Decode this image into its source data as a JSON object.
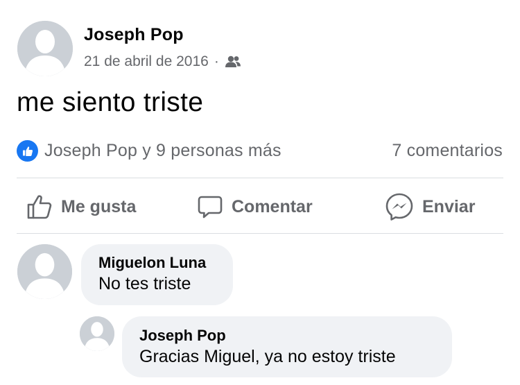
{
  "post": {
    "author": "Joseph Pop",
    "date": "21 de abril de 2016",
    "separator": "·",
    "audience_icon": "friends-icon",
    "text": "me siento triste"
  },
  "reactions": {
    "icon": "like-badge-icon",
    "summary": "Joseph Pop y 9 personas más",
    "comments_count": "7 comentarios"
  },
  "actions": {
    "like_label": "Me gusta",
    "comment_label": "Comentar",
    "send_label": "Enviar"
  },
  "comments": [
    {
      "author": "Miguelon Luna",
      "text": "No tes triste"
    },
    {
      "author": "Joseph Pop",
      "text": "Gracias Miguel, ya no estoy triste"
    }
  ],
  "colors": {
    "accent": "#1877f2",
    "secondary_text": "#65676b",
    "bubble": "#f0f2f5",
    "avatar_placeholder": "#cbd0d6"
  }
}
